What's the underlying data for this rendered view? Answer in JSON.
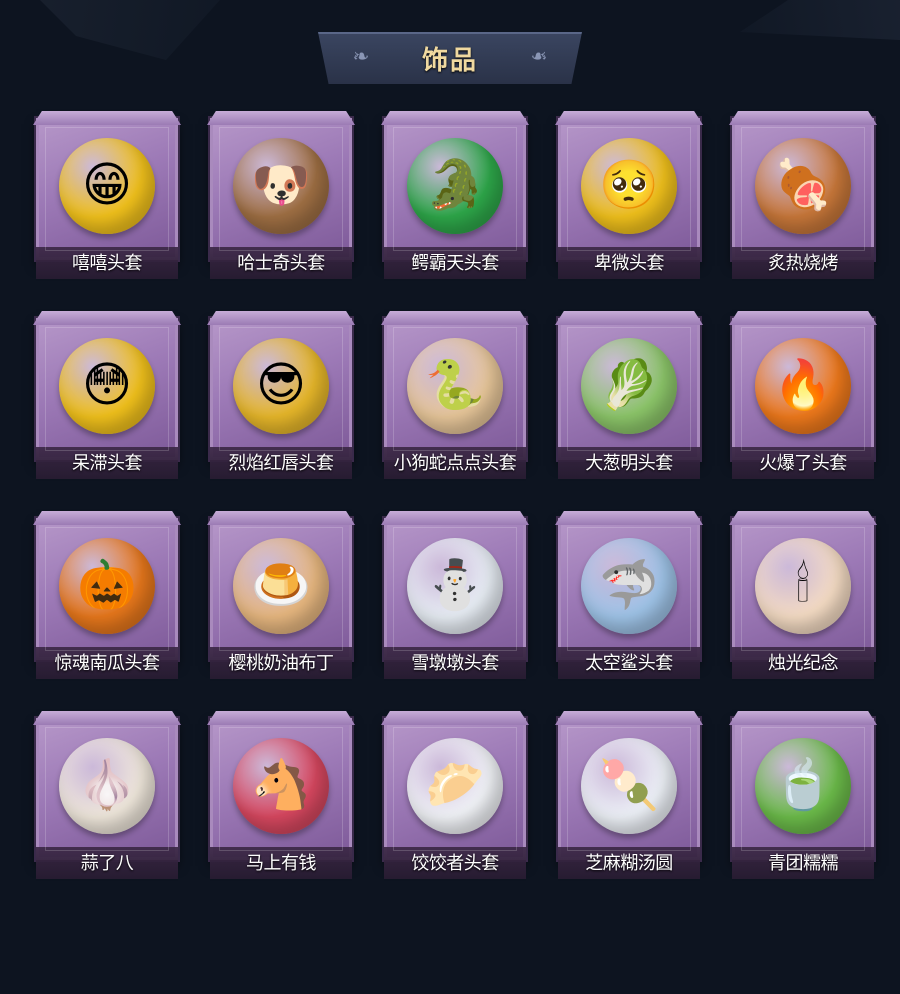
{
  "header": {
    "title": "饰品"
  },
  "items": [
    {
      "name": "嘻嘻头套",
      "icon": "grinning-face-icon",
      "color": "#f2c21c",
      "glyph": "😁"
    },
    {
      "name": "哈士奇头套",
      "icon": "husky-sunglasses-icon",
      "color": "#a07044",
      "glyph": "🐶"
    },
    {
      "name": "鳄霸天头套",
      "icon": "crocodile-icon",
      "color": "#2ea84a",
      "glyph": "🐊"
    },
    {
      "name": "卑微头套",
      "icon": "humble-face-icon",
      "color": "#f2c21c",
      "glyph": "🥺"
    },
    {
      "name": "炙热烧烤",
      "icon": "bbq-meat-icon",
      "color": "#c9783a",
      "glyph": "🍖"
    },
    {
      "name": "呆滞头套",
      "icon": "dazed-face-icon",
      "color": "#f2c21c",
      "glyph": "😳"
    },
    {
      "name": "烈焰红唇头套",
      "icon": "yellow-mask-sunglasses-icon",
      "color": "#e8b82a",
      "glyph": "😎"
    },
    {
      "name": "小狗蛇点点头套",
      "icon": "snake-icon",
      "color": "#e8c79a",
      "glyph": "🐍"
    },
    {
      "name": "大葱明头套",
      "icon": "green-onion-icon",
      "color": "#8dc76a",
      "glyph": "🥬"
    },
    {
      "name": "火爆了头套",
      "icon": "fire-face-icon",
      "color": "#f07a1c",
      "glyph": "🔥"
    },
    {
      "name": "惊魂南瓜头套",
      "icon": "pumpkin-icon",
      "color": "#e8781c",
      "glyph": "🎃"
    },
    {
      "name": "樱桃奶油布丁",
      "icon": "pudding-icon",
      "color": "#e8b880",
      "glyph": "🍮"
    },
    {
      "name": "雪墩墩头套",
      "icon": "snowman-icon",
      "color": "#e8eef5",
      "glyph": "⛄"
    },
    {
      "name": "太空鲨头套",
      "icon": "shark-icon",
      "color": "#9fc4e8",
      "glyph": "🦈"
    },
    {
      "name": "烛光纪念",
      "icon": "candle-icon",
      "color": "#f5dcc4",
      "glyph": "🕯"
    },
    {
      "name": "蒜了八",
      "icon": "garlic-icon",
      "color": "#f0e8dc",
      "glyph": "🧄"
    },
    {
      "name": "马上有钱",
      "icon": "red-horse-icon",
      "color": "#d84860",
      "glyph": "🐴"
    },
    {
      "name": "饺饺者头套",
      "icon": "dumpling-icon",
      "color": "#f2f4f8",
      "glyph": "🥟"
    },
    {
      "name": "芝麻糊汤圆",
      "icon": "tangyuan-icon",
      "color": "#eef2f8",
      "glyph": "🍡"
    },
    {
      "name": "青团糯糯",
      "icon": "green-rice-ball-icon",
      "color": "#6cbc4a",
      "glyph": "🍵"
    }
  ]
}
